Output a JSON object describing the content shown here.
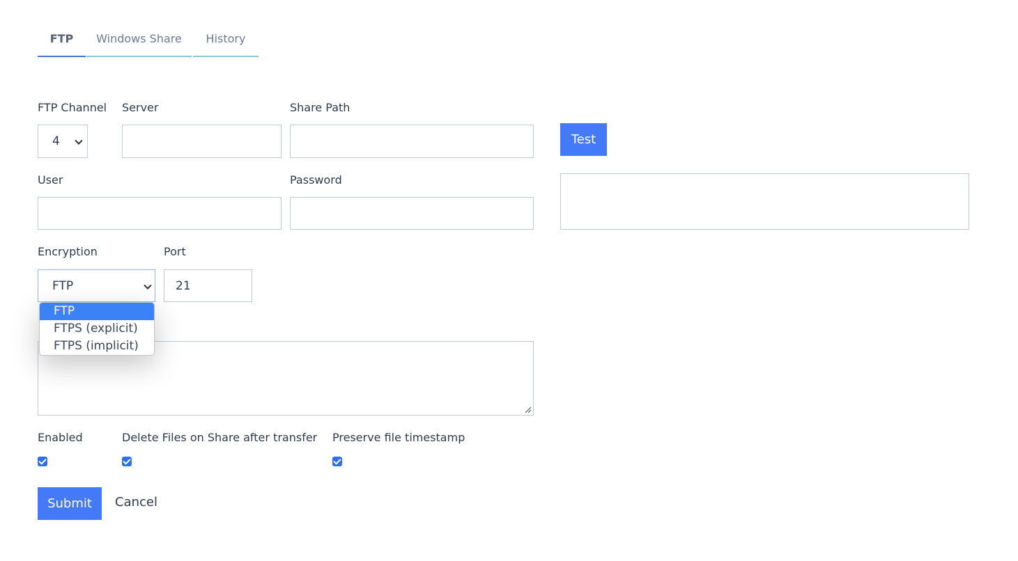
{
  "tabs": [
    {
      "label": "FTP",
      "active": true
    },
    {
      "label": "Windows Share",
      "active": false
    },
    {
      "label": "History",
      "active": false
    }
  ],
  "form": {
    "ftp_channel": {
      "label": "FTP Channel",
      "value": "4"
    },
    "server": {
      "label": "Server",
      "value": ""
    },
    "share_path": {
      "label": "Share Path",
      "value": ""
    },
    "user": {
      "label": "User",
      "value": ""
    },
    "password": {
      "label": "Password",
      "value": ""
    },
    "encryption": {
      "label": "Encryption",
      "value": "FTP",
      "options": [
        "FTP",
        "FTPS (explicit)",
        "FTPS (implicit)"
      ]
    },
    "port": {
      "label": "Port",
      "value": "21"
    },
    "notes": {
      "value": ""
    },
    "test_output": {
      "value": ""
    }
  },
  "checkboxes": [
    {
      "label": "Enabled",
      "checked": true
    },
    {
      "label": "Delete Files on Share after transfer",
      "checked": true
    },
    {
      "label": "Preserve file timestamp",
      "checked": true
    }
  ],
  "buttons": {
    "test": "Test",
    "submit": "Submit",
    "cancel": "Cancel"
  },
  "colors": {
    "accent": "#4479f7",
    "highlight": "#3b82f6"
  }
}
